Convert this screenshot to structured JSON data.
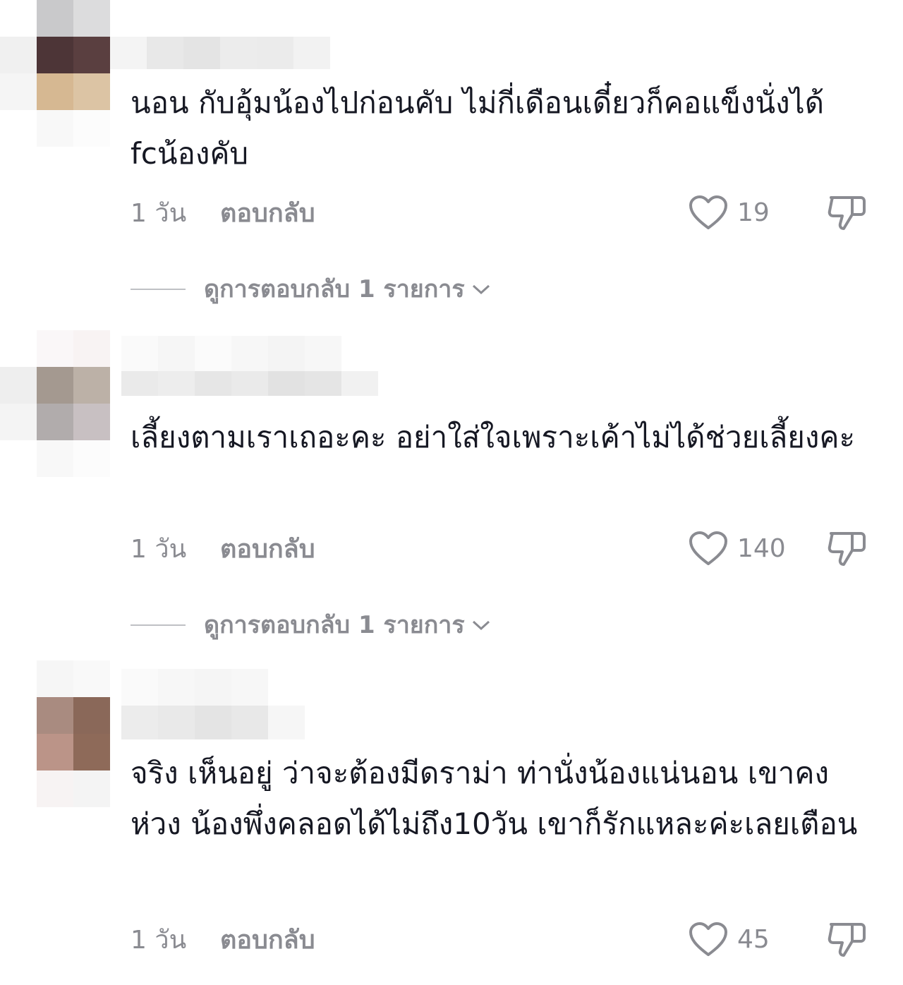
{
  "comments": [
    {
      "text": "นอน กับอุ้มน้องไปก่อนคับ ไม่กี่เดือนเดี๋ยวก็คอแข็งนั่งได้ fcน้องคับ",
      "time": "1 วัน",
      "reply_label": "ตอบกลับ",
      "likes": "19",
      "view_replies": "ดูการตอบกลับ 1 รายการ"
    },
    {
      "text": "เลี้ยงตามเราเถอะคะ อย่าใส่ใจเพราะเค้าไม่ได้ช่วยเลี้ยงคะ",
      "time": "1 วัน",
      "reply_label": "ตอบกลับ",
      "likes": "140",
      "view_replies": "ดูการตอบกลับ 1 รายการ"
    },
    {
      "text": "จริง เห็นอยู่ ว่าจะต้องมีดราม่า ท่านั่งน้องแน่นอน เขาคงห่วง น้องพึ่งคลอดได้ไม่ถึง10วัน เขาก็รักแหละค่ะเลยเตือน",
      "time": "1 วัน",
      "reply_label": "ตอบกลับ",
      "likes": "45"
    }
  ],
  "icons": {
    "like": "heart-outline-icon",
    "dislike": "thumbs-down-icon",
    "expand": "chevron-down-icon"
  },
  "colors": {
    "text": "#161823",
    "muted": "#8a8b91"
  }
}
